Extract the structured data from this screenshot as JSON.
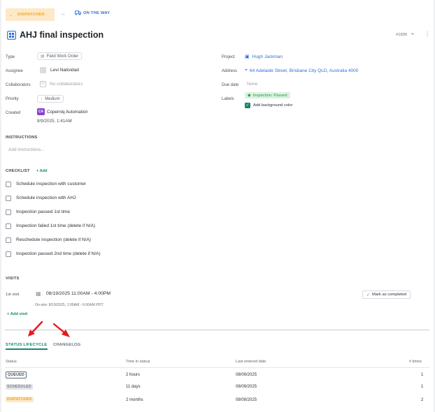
{
  "status_bar": {
    "current_status": "DISPATCHED",
    "next_status": "ON THE WAY",
    "colors": {
      "dispatched_bg": "#fde9c7",
      "dispatched_text": "#f0a42b",
      "next_text": "#2f6fdb"
    }
  },
  "header": {
    "title": "AHJ final inspection",
    "id": "#1836"
  },
  "fields_left": {
    "type": {
      "label": "Type",
      "value": "Field Work Order"
    },
    "assignee": {
      "label": "Assignee",
      "value": "Levi Natividad"
    },
    "collaborators": {
      "label": "Collaborators",
      "value": "No collaborators"
    },
    "priority": {
      "label": "Priority",
      "value": "Medium"
    },
    "created": {
      "label": "Created",
      "avatar": "CA",
      "by": "Coperniq Automation",
      "date": "8/9/2025, 1:41AM"
    }
  },
  "fields_right": {
    "project": {
      "label": "Project",
      "value": "Hugh Jackman"
    },
    "address": {
      "label": "Address",
      "value": "64 Adelaide Street, Brisbane City QLD, Australia 4000"
    },
    "due_date": {
      "label": "Due date",
      "value": "None"
    },
    "labels": {
      "label": "Labels",
      "tag": "Inspection: Passed",
      "checkbox": "Add background color"
    }
  },
  "instructions": {
    "heading": "INSTRUCTIONS",
    "placeholder": "Add instructions..."
  },
  "checklist": {
    "heading": "CHECKLIST",
    "add_label": "+ Add",
    "items": [
      "Schedule inspection with customer",
      "Schedule inspection with AHJ",
      "Inspection passed 1st time",
      "Inspection failed 1st time (delete if N/A)",
      "Reschedule inspection (delete if N/A)",
      "Inspection passed 2nd time (delete if N/A)"
    ]
  },
  "visits": {
    "heading": "VISITS",
    "visit_label": "1st visit",
    "datetime": "08/19/2025 11:00AM - 4:00PM",
    "onsite": "On-site: 8/19/2025, 1:00AM - 6:00AM PDT",
    "mark_completed": "Mark as completed",
    "add_visit": "+ Add visit"
  },
  "tabs": {
    "lifecycle": "STATUS LIFECYCLE",
    "changelog": "CHANGELOG"
  },
  "lifecycle_table": {
    "headers": [
      "Status",
      "Time in status",
      "Last entered date",
      "# times"
    ],
    "rows": [
      {
        "status": "QUEUED",
        "time": "2 hours",
        "date": "08/09/2025",
        "times": "1"
      },
      {
        "status": "SCHEDULED",
        "time": "11 days",
        "date": "08/09/2025",
        "times": "1"
      },
      {
        "status": "DISPATCHED",
        "time": "2 months",
        "date": "08/09/2025",
        "times": "2"
      }
    ]
  }
}
